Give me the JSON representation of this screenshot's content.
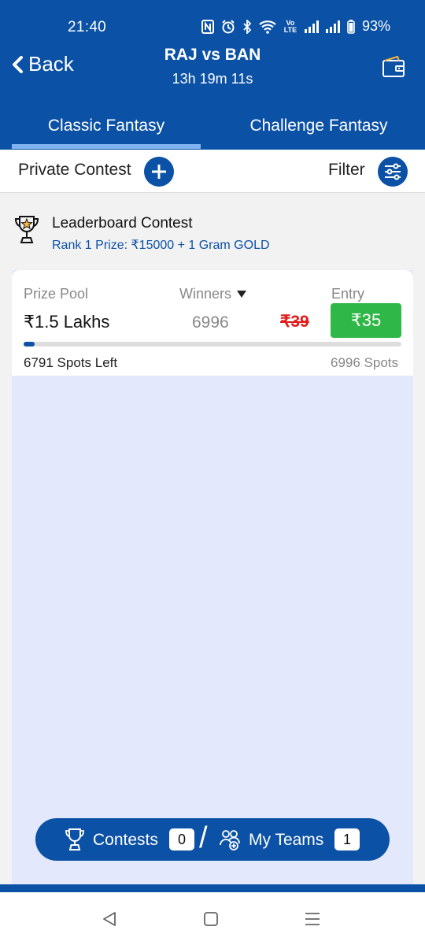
{
  "status_bar": {
    "time": "21:40",
    "battery": "93%",
    "icons": [
      "nfc-icon",
      "alarm-icon",
      "bluetooth-icon",
      "wifi-icon",
      "volte-icon",
      "signal-icon",
      "signal-icon",
      "battery-icon"
    ],
    "volte_label": "Vo LTE"
  },
  "header": {
    "back_label": "Back",
    "match_title": "RAJ vs BAN",
    "countdown": "13h 19m 11s",
    "wallet_icon": "wallet-icon",
    "bg_color": "#0b51a6"
  },
  "tabs": [
    {
      "label": "Classic Fantasy",
      "active": true
    },
    {
      "label": "Challenge Fantasy",
      "active": false
    }
  ],
  "toolbar": {
    "private_contest_label": "Private Contest",
    "filter_label": "Filter"
  },
  "leaderboard": {
    "title": "Leaderboard Contest",
    "subtitle": "Rank 1 Prize: ₹15000 + 1 Gram GOLD"
  },
  "contest_card": {
    "prize_pool_label": "Prize Pool",
    "winners_label": "Winners",
    "entry_label": "Entry",
    "prize_pool_value": "₹1.5 Lakhs",
    "winners_value": "6996",
    "original_price": "₹39",
    "entry_price": "₹35",
    "spots_left": "6791 Spots Left",
    "total_spots": "6996 Spots",
    "filled_fraction": 0.029,
    "entry_color": "#2fb847",
    "strike_color": "#e01a1a"
  },
  "bottom_bar": {
    "contests_label": "Contests",
    "contests_count": "0",
    "separator": "/",
    "my_teams_label": "My Teams",
    "my_teams_count": "1"
  },
  "nav": {
    "back_icon": "nav-back-icon",
    "home_icon": "nav-home-icon",
    "recent_icon": "nav-recents-icon"
  }
}
